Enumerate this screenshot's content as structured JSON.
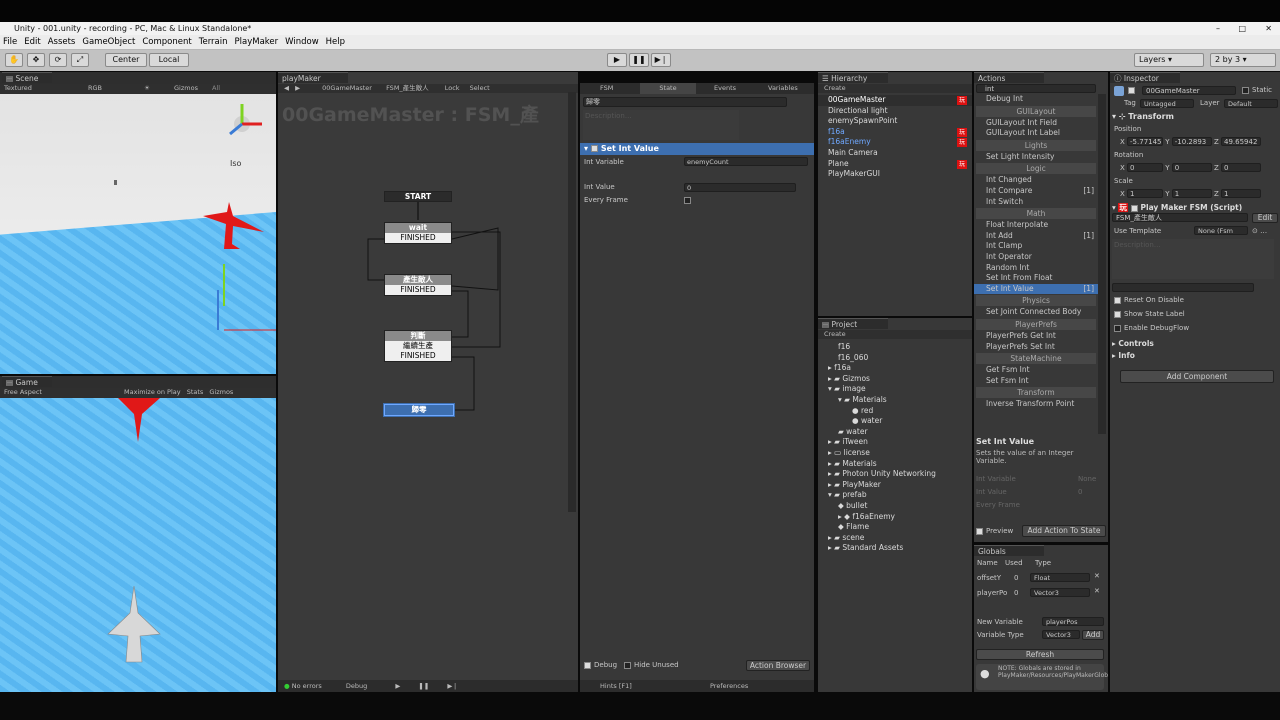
{
  "title": {
    "window": "Unity - 001.unity - recording - PC, Mac & Linux Standalone*"
  },
  "menu": [
    "File",
    "Edit",
    "Assets",
    "GameObject",
    "Component",
    "Terrain",
    "PlayMaker",
    "Window",
    "Help"
  ],
  "toolbar": {
    "center": "Center",
    "local": "Local",
    "layers": "Layers",
    "layout": "2 by 3"
  },
  "scene": {
    "tab": "Scene",
    "shading": "Textured",
    "rgb": "RGB",
    "gizmos": "Gizmos",
    "all": "All",
    "iso": "Iso"
  },
  "game": {
    "tab": "Game",
    "aspect": "Free Aspect",
    "maximize": "Maximize on Play",
    "stats": "Stats",
    "gizmos": "Gizmos"
  },
  "playmaker": {
    "tab": "playMaker",
    "object": "00GameMaster",
    "fsm": "FSM_產生敵人",
    "lock": "Lock",
    "select": "Select",
    "watermark": "00GameMaster : FSM_產",
    "no_errors": "No errors",
    "debug": "Debug",
    "start": "START",
    "nodes": [
      {
        "name": "wait",
        "event": "FINISHED"
      },
      {
        "name": "產生敵人",
        "event": "FINISHED"
      },
      {
        "name": "判斷",
        "event": "繼續生產",
        "event2": "FINISHED"
      },
      {
        "name": "歸零"
      }
    ]
  },
  "fsm_tabs": {
    "fsm": "FSM",
    "state": "State",
    "events": "Events",
    "variables": "Variables",
    "state_name": "歸零",
    "description": "Description...",
    "action": "Set Int Value",
    "int_variable_label": "Int Variable",
    "int_variable_value": "enemyCount",
    "int_value_label": "Int Value",
    "int_value": "0",
    "every_frame": "Every Frame",
    "debug": "Debug",
    "hide_unused": "Hide Unused",
    "action_browser": "Action Browser",
    "hints": "Hints [F1]",
    "preferences": "Preferences"
  },
  "hierarchy": {
    "tab": "Hierarchy",
    "create": "Create",
    "items": [
      "00GameMaster",
      "Directional light",
      "enemySpawnPoint",
      "f16a",
      "f16aEnemy",
      "Main Camera",
      "Plane",
      "PlayMakerGUI"
    ],
    "badge": "玩"
  },
  "project": {
    "tab": "Project",
    "create": "Create",
    "items": [
      "f16",
      "f16_060",
      "f16a",
      "Gizmos",
      "image",
      "Materials",
      "red",
      "water",
      "water",
      "iTween",
      "license",
      "Materials",
      "Photon Unity Networking",
      "PlayMaker",
      "prefab",
      "bullet",
      "f16aEnemy",
      "Flame",
      "scene",
      "Standard Assets"
    ]
  },
  "actions": {
    "tab": "Actions",
    "search": "int",
    "list": [
      {
        "t": "i",
        "v": "Debug Int"
      },
      {
        "t": "s",
        "v": "GUILayout"
      },
      {
        "t": "i",
        "v": "GUILayout Int Field"
      },
      {
        "t": "i",
        "v": "GUILayout Int Label"
      },
      {
        "t": "s",
        "v": "Lights"
      },
      {
        "t": "i",
        "v": "Set Light Intensity"
      },
      {
        "t": "s",
        "v": "Logic"
      },
      {
        "t": "i",
        "v": "Int Changed"
      },
      {
        "t": "i",
        "v": "Int Compare",
        "c": "[1]"
      },
      {
        "t": "i",
        "v": "Int Switch"
      },
      {
        "t": "s",
        "v": "Math"
      },
      {
        "t": "i",
        "v": "Float Interpolate"
      },
      {
        "t": "i",
        "v": "Int Add",
        "c": "[1]"
      },
      {
        "t": "i",
        "v": "Int Clamp"
      },
      {
        "t": "i",
        "v": "Int Operator"
      },
      {
        "t": "i",
        "v": "Random Int"
      },
      {
        "t": "i",
        "v": "Set Int From Float"
      },
      {
        "t": "h",
        "v": "Set Int Value",
        "c": "[1]"
      },
      {
        "t": "s",
        "v": "Physics"
      },
      {
        "t": "i",
        "v": "Set Joint Connected Body"
      },
      {
        "t": "s",
        "v": "PlayerPrefs"
      },
      {
        "t": "i",
        "v": "PlayerPrefs Get Int"
      },
      {
        "t": "i",
        "v": "PlayerPrefs Set Int"
      },
      {
        "t": "s",
        "v": "StateMachine"
      },
      {
        "t": "i",
        "v": "Get Fsm Int"
      },
      {
        "t": "i",
        "v": "Set Fsm Int"
      },
      {
        "t": "s",
        "v": "Transform"
      },
      {
        "t": "i",
        "v": "Inverse Transform Point"
      }
    ],
    "help_title": "Set Int Value",
    "help_text": "Sets the value of an Integer Variable.",
    "f1": "Int Variable",
    "f2": "Int Value",
    "f3": "Every Frame",
    "none": "None",
    "zero": "0",
    "preview": "Preview",
    "add_to_state": "Add Action To State"
  },
  "globals": {
    "tab": "Globals",
    "name": "Name",
    "used": "Used",
    "type": "Type",
    "rows": [
      {
        "n": "offsetY",
        "u": "0",
        "t": "Float"
      },
      {
        "n": "playerPo",
        "u": "0",
        "t": "Vector3"
      }
    ],
    "new_variable": "New Variable",
    "new_value": "playerPos",
    "variable_type": "Variable Type",
    "type_value": "Vector3",
    "add": "Add",
    "refresh": "Refresh",
    "note": "NOTE: Globals are stored in PlayMaker/Resources/PlayMakerGlobals.asset"
  },
  "inspector": {
    "tab": "Inspector",
    "object": "00GameMaster",
    "static": "Static",
    "tag": "Tag",
    "tag_value": "Untagged",
    "layer": "Layer",
    "layer_value": "Default",
    "transform": "Transform",
    "position": "Position",
    "px": "-5.77145",
    "py": "-10.2893",
    "pz": "49.65942",
    "rotation": "Rotation",
    "rx": "0",
    "ry": "0",
    "rz": "0",
    "scale": "Scale",
    "sx": "1",
    "sy": "1",
    "sz": "1",
    "fsm_comp": "Play Maker FSM (Script)",
    "fsm_name": "FSM_產生敵人",
    "edit": "Edit",
    "use_template": "Use Template",
    "template_value": "None (Fsm",
    "description": "Description...",
    "reset": "Reset On Disable",
    "show_label": "Show State Label",
    "debug_flow": "Enable DebugFlow",
    "controls": "Controls",
    "info": "Info",
    "add_component": "Add Component"
  }
}
